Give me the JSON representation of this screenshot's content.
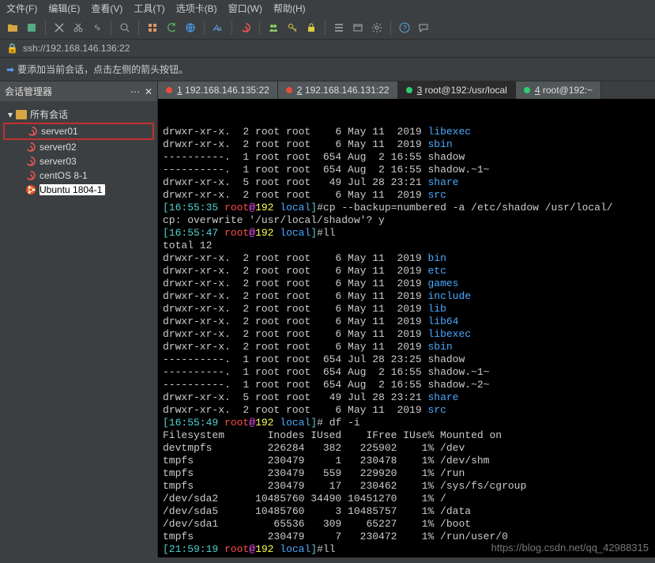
{
  "menu": {
    "items": [
      "文件(F)",
      "编辑(E)",
      "查看(V)",
      "工具(T)",
      "选项卡(B)",
      "窗口(W)",
      "帮助(H)"
    ]
  },
  "toolbar": {
    "icons": [
      "folder-icon",
      "save-icon",
      "cut-icon",
      "scissors-icon",
      "link-icon",
      "search-icon",
      "grid-icon",
      "refresh-icon",
      "globe-icon",
      "font-icon",
      "swirl-icon",
      "people-icon",
      "key-icon",
      "lock-icon",
      "list-icon",
      "window-icon",
      "gear-icon",
      "help-icon",
      "chat-icon"
    ]
  },
  "address": {
    "url": "ssh://192.168.146.136:22"
  },
  "hint": {
    "text": "要添加当前会话，点击左侧的箭头按钮。"
  },
  "sidebar": {
    "title": "会话管理器",
    "root": "所有会话",
    "items": [
      {
        "name": "server01",
        "kind": "swirl",
        "boxed": true
      },
      {
        "name": "server02",
        "kind": "swirl"
      },
      {
        "name": "server03",
        "kind": "swirl"
      },
      {
        "name": "centOS 8-1",
        "kind": "swirl"
      },
      {
        "name": "Ubuntu 1804-1",
        "kind": "ubuntu",
        "selected": true
      }
    ]
  },
  "tabs": [
    {
      "num": "1",
      "label": "192.168.146.135:22",
      "status": "red"
    },
    {
      "num": "2",
      "label": "192.168.146.131:22",
      "status": "red"
    },
    {
      "num": "3",
      "label": "root@192:/usr/local",
      "status": "green",
      "active": true
    },
    {
      "num": "4",
      "label": "root@192:~",
      "status": "green"
    }
  ],
  "prompt": {
    "p1": {
      "time": "16:55:35",
      "user": "root",
      "at": "@",
      "host": "192",
      "path": "local",
      "cmd": "#cp --backup=numbered -a /etc/shadow /usr/local/"
    },
    "overwrite": "cp: overwrite '/usr/local/shadow'? y",
    "p2": {
      "time": "16:55:47",
      "user": "root",
      "at": "@",
      "host": "192",
      "path": "local",
      "cmd": "#ll"
    },
    "total": "total 12",
    "p3": {
      "time": "16:55:49",
      "user": "root",
      "at": "@",
      "host": "192",
      "path": "local",
      "cmd": "# df -i"
    },
    "df_header": "Filesystem       Inodes IUsed    IFree IUse% Mounted on",
    "p4": {
      "time": "21:59:19",
      "user": "root",
      "at": "@",
      "host": "192",
      "path": "local",
      "cmd": "#ll"
    }
  },
  "ls1": [
    {
      "l": "drwxr-xr-x.  2 root root    6 May 11  2019 ",
      "n": "libexec",
      "c": "c-blue"
    },
    {
      "l": "drwxr-xr-x.  2 root root    6 May 11  2019 ",
      "n": "sbin",
      "c": "c-blue"
    },
    {
      "l": "----------.  1 root root  654 Aug  2 16:55 ",
      "n": "shadow",
      "c": ""
    },
    {
      "l": "----------.  1 root root  654 Aug  2 16:55 ",
      "n": "shadow.~1~",
      "c": ""
    },
    {
      "l": "drwxr-xr-x.  5 root root   49 Jul 28 23:21 ",
      "n": "share",
      "c": "c-blue"
    },
    {
      "l": "drwxr-xr-x.  2 root root    6 May 11  2019 ",
      "n": "src",
      "c": "c-blue"
    }
  ],
  "ls2": [
    {
      "l": "drwxr-xr-x.  2 root root    6 May 11  2019 ",
      "n": "bin",
      "c": "c-blue"
    },
    {
      "l": "drwxr-xr-x.  2 root root    6 May 11  2019 ",
      "n": "etc",
      "c": "c-blue"
    },
    {
      "l": "drwxr-xr-x.  2 root root    6 May 11  2019 ",
      "n": "games",
      "c": "c-blue"
    },
    {
      "l": "drwxr-xr-x.  2 root root    6 May 11  2019 ",
      "n": "include",
      "c": "c-blue"
    },
    {
      "l": "drwxr-xr-x.  2 root root    6 May 11  2019 ",
      "n": "lib",
      "c": "c-blue"
    },
    {
      "l": "drwxr-xr-x.  2 root root    6 May 11  2019 ",
      "n": "lib64",
      "c": "c-blue"
    },
    {
      "l": "drwxr-xr-x.  2 root root    6 May 11  2019 ",
      "n": "libexec",
      "c": "c-blue"
    },
    {
      "l": "drwxr-xr-x.  2 root root    6 May 11  2019 ",
      "n": "sbin",
      "c": "c-blue"
    },
    {
      "l": "----------.  1 root root  654 Jul 28 23:25 ",
      "n": "shadow",
      "c": ""
    },
    {
      "l": "----------.  1 root root  654 Aug  2 16:55 ",
      "n": "shadow.~1~",
      "c": ""
    },
    {
      "l": "----------.  1 root root  654 Aug  2 16:55 ",
      "n": "shadow.~2~",
      "c": ""
    },
    {
      "l": "drwxr-xr-x.  5 root root   49 Jul 28 23:21 ",
      "n": "share",
      "c": "c-blue"
    },
    {
      "l": "drwxr-xr-x.  2 root root    6 May 11  2019 ",
      "n": "src",
      "c": "c-blue"
    }
  ],
  "df": [
    "devtmpfs         226284   382   225902    1% /dev",
    "tmpfs            230479     1   230478    1% /dev/shm",
    "tmpfs            230479   559   229920    1% /run",
    "tmpfs            230479    17   230462    1% /sys/fs/cgroup",
    "/dev/sda2      10485760 34490 10451270    1% /",
    "/dev/sda5      10485760     3 10485757    1% /data",
    "/dev/sda1         65536   309    65227    1% /boot",
    "tmpfs            230479     7   230472    1% /run/user/0"
  ],
  "watermark": "https://blog.csdn.net/qq_42988315"
}
